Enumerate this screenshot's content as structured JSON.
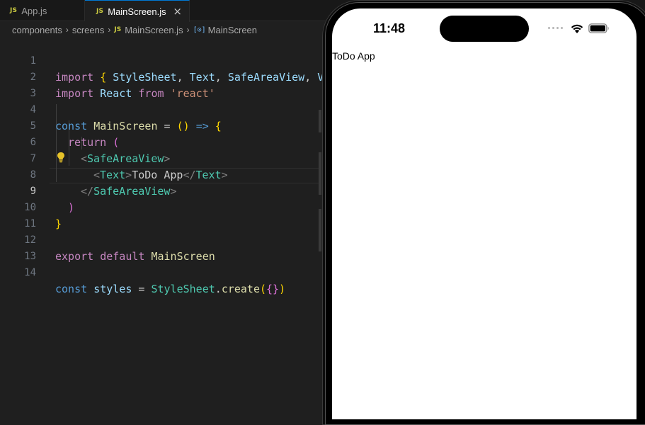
{
  "editor": {
    "tabs": [
      {
        "icon_label": "JS",
        "label": "App.js",
        "active": false
      },
      {
        "icon_label": "JS",
        "label": "MainScreen.js",
        "active": true,
        "close": "×"
      }
    ],
    "breadcrumbs": {
      "folder1": "components",
      "folder2": "screens",
      "file_icon": "JS",
      "file": "MainScreen.js",
      "symbol_icon": "[⊙]",
      "symbol": "MainScreen",
      "separator": "›"
    },
    "line_numbers": [
      "1",
      "2",
      "3",
      "4",
      "5",
      "6",
      "7",
      "8",
      "9",
      "10",
      "11",
      "12",
      "13",
      "14"
    ],
    "active_line": "9",
    "code": {
      "l1": {
        "kw": "import",
        "ob": "{",
        "a": "StyleSheet",
        "c1": ",",
        "b": "Text",
        "c2": ",",
        "c": "SafeAreaView",
        "c3": ",",
        "d": "V"
      },
      "l2": {
        "kw": "import",
        "name": "React",
        "from": "from",
        "str": "'react'"
      },
      "l4": {
        "const": "const",
        "name": "MainScreen",
        "eq": "=",
        "paren": "()",
        "arrow": "=>",
        "brace": "{"
      },
      "l5": {
        "ret": "return",
        "paren": "("
      },
      "l6": {
        "lt": "<",
        "tag": "SafeAreaView",
        "gt": ">"
      },
      "l7": {
        "lt": "<",
        "tag": "Text",
        "gt": ">",
        "content": "ToDo App",
        "lt2": "</",
        "tag2": "Text",
        "gt2": ">"
      },
      "l8": {
        "lt": "</",
        "tag": "SafeAreaView",
        "gt": ">"
      },
      "l9": {
        "paren": ")"
      },
      "l10": {
        "brace": "}"
      },
      "l12": {
        "exp": "export",
        "def": "default",
        "name": "MainScreen"
      },
      "l14": {
        "const": "const",
        "name": "styles",
        "eq": "=",
        "obj": "StyleSheet",
        "dot": ".",
        "fn": "create",
        "p1": "(",
        "b": "{}",
        "p2": ")"
      }
    }
  },
  "simulator": {
    "time": "11:48",
    "app_text": "ToDo App"
  },
  "colors": {
    "editor_bg": "#1f1f1f",
    "keyword": "#c586c0",
    "storage": "#569cd6",
    "variable": "#9cdcfe",
    "function": "#dcdcaa",
    "string": "#ce9178",
    "tag": "#4ec9b0",
    "accent": "#0078d4"
  }
}
